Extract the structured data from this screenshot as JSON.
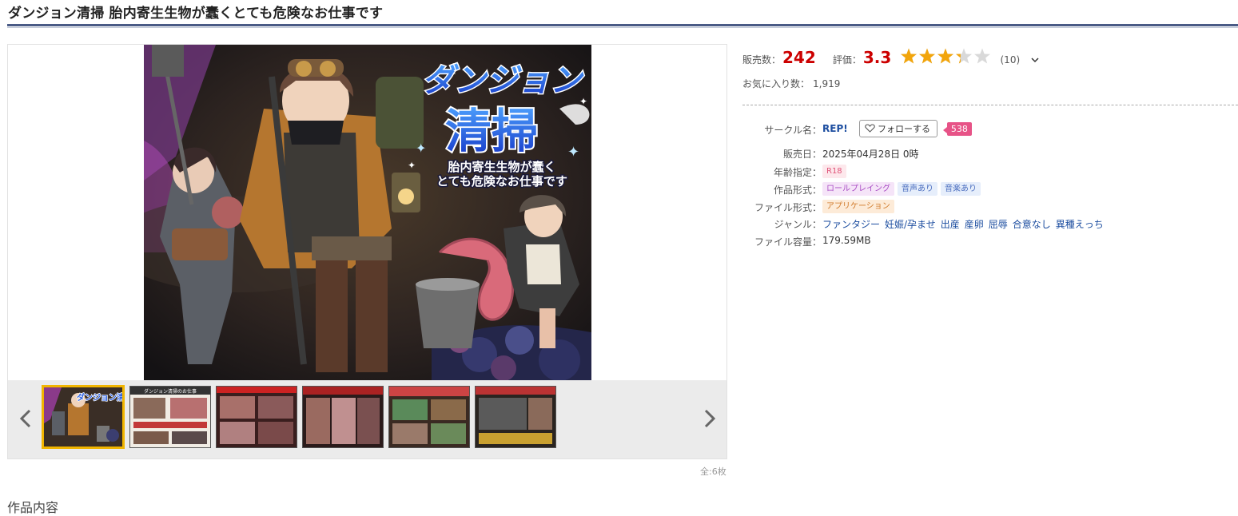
{
  "title": "ダンジョン清掃 胎内寄生生物が蠢くとても危険なお仕事です",
  "cover": {
    "title_line1": "ダンジョン",
    "title_line2": "清掃",
    "subtitle_line1": "胎内寄生生物が蠢く",
    "subtitle_line2": "とても危険なお仕事です"
  },
  "gallery": {
    "page_count": "全:6枚",
    "thumb_texts": [
      "ダンジョン清掃",
      "ダンジョン清掃のお仕事",
      "",
      "",
      "",
      ""
    ]
  },
  "stats": {
    "sales_label": "販売数：",
    "sales_value": "242",
    "rating_label": "評価：",
    "rating_value": "3.3",
    "rating_fraction": 0.66,
    "rating_count": "(10)",
    "favorites_label": "お気に入り数：",
    "favorites_value": "1,919"
  },
  "details": {
    "circle_label": "サークル名：",
    "circle_name": "REP!",
    "follow_label": "フォローする",
    "follow_count": "538",
    "release_label": "販売日：",
    "release_value": "2025年04月28日 0時",
    "age_label": "年齢指定：",
    "age_value": "R18",
    "format_label": "作品形式：",
    "format_tags": [
      "ロールプレイング",
      "音声あり",
      "音楽あり"
    ],
    "file_format_label": "ファイル形式：",
    "file_format_value": "アプリケーション",
    "genre_label": "ジャンル：",
    "genres": [
      "ファンタジー",
      "妊娠/孕ませ",
      "出産",
      "産卵",
      "屈辱",
      "合意なし",
      "異種えっち"
    ],
    "size_label": "ファイル容量：",
    "size_value": "179.59MB"
  },
  "section_heading": "作品内容",
  "colors": {
    "accent_red": "#cc0000",
    "star_gold": "#f2a50c",
    "link_blue": "#1d4ea0",
    "title_rule": "#4a5b86"
  }
}
